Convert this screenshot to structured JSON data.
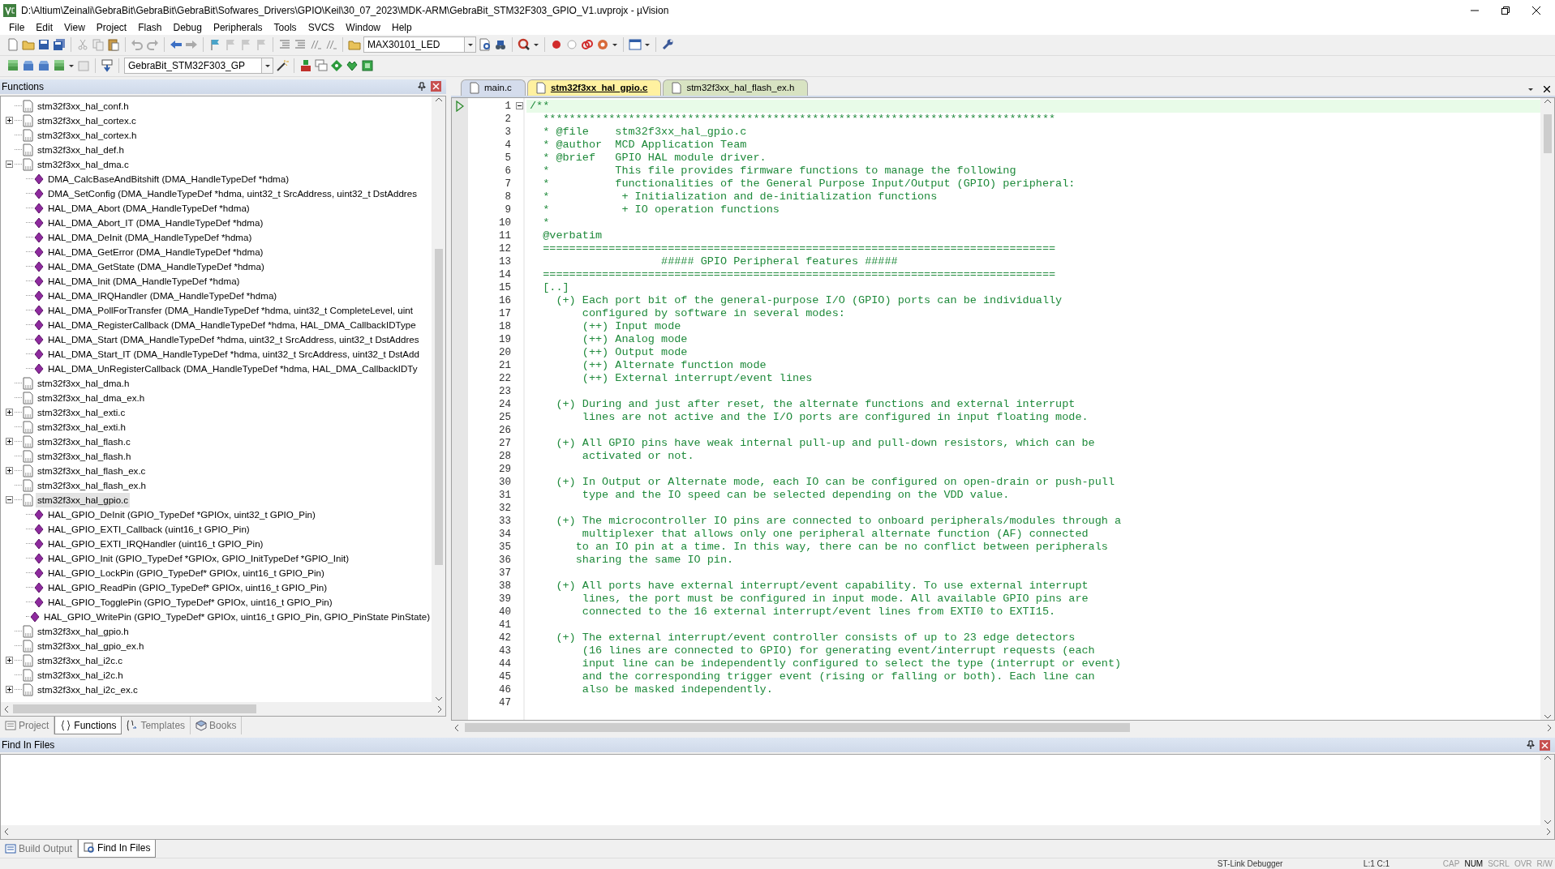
{
  "window": {
    "title": "D:\\Altium\\Zeinali\\GebraBit\\GebraBit\\GebraBit\\Sofwares_Drivers\\GPIO\\Keil\\30_07_2023\\MDK-ARM\\GebraBit_STM32F303_GPIO_V1.uvprojx - µVision"
  },
  "menu": [
    "File",
    "Edit",
    "View",
    "Project",
    "Flash",
    "Debug",
    "Peripherals",
    "Tools",
    "SVCS",
    "Window",
    "Help"
  ],
  "toolbar": {
    "find_combo": "MAX30101_LED",
    "target_combo": "GebraBit_STM32F303_GP"
  },
  "functions_panel": {
    "title": "Functions",
    "tree": [
      {
        "label": "stm32f3xx_hal_conf.h",
        "kind": "file",
        "selected": false
      },
      {
        "label": "stm32f3xx_hal_cortex.c",
        "kind": "file",
        "selected": false,
        "expanded": false
      },
      {
        "label": "stm32f3xx_hal_cortex.h",
        "kind": "file",
        "selected": false
      },
      {
        "label": "stm32f3xx_hal_def.h",
        "kind": "file",
        "selected": false
      },
      {
        "label": "stm32f3xx_hal_dma.c",
        "kind": "file",
        "selected": false,
        "expanded": true,
        "children": [
          {
            "label": "DMA_CalcBaseAndBitshift (DMA_HandleTypeDef *hdma)",
            "kind": "function",
            "selected": false
          },
          {
            "label": "DMA_SetConfig (DMA_HandleTypeDef *hdma, uint32_t SrcAddress, uint32_t DstAddres",
            "kind": "function",
            "selected": false
          },
          {
            "label": "HAL_DMA_Abort (DMA_HandleTypeDef *hdma)",
            "kind": "function",
            "selected": false
          },
          {
            "label": "HAL_DMA_Abort_IT (DMA_HandleTypeDef *hdma)",
            "kind": "function",
            "selected": false
          },
          {
            "label": "HAL_DMA_DeInit (DMA_HandleTypeDef *hdma)",
            "kind": "function",
            "selected": false
          },
          {
            "label": "HAL_DMA_GetError (DMA_HandleTypeDef *hdma)",
            "kind": "function",
            "selected": false
          },
          {
            "label": "HAL_DMA_GetState (DMA_HandleTypeDef *hdma)",
            "kind": "function",
            "selected": false
          },
          {
            "label": "HAL_DMA_Init (DMA_HandleTypeDef *hdma)",
            "kind": "function",
            "selected": false
          },
          {
            "label": "HAL_DMA_IRQHandler (DMA_HandleTypeDef *hdma)",
            "kind": "function",
            "selected": false
          },
          {
            "label": "HAL_DMA_PollForTransfer (DMA_HandleTypeDef *hdma, uint32_t CompleteLevel, uint",
            "kind": "function",
            "selected": false
          },
          {
            "label": "HAL_DMA_RegisterCallback (DMA_HandleTypeDef *hdma, HAL_DMA_CallbackIDType",
            "kind": "function",
            "selected": false
          },
          {
            "label": "HAL_DMA_Start (DMA_HandleTypeDef *hdma, uint32_t SrcAddress, uint32_t DstAddres",
            "kind": "function",
            "selected": false
          },
          {
            "label": "HAL_DMA_Start_IT (DMA_HandleTypeDef *hdma, uint32_t SrcAddress, uint32_t DstAdd",
            "kind": "function",
            "selected": false
          },
          {
            "label": "HAL_DMA_UnRegisterCallback (DMA_HandleTypeDef *hdma, HAL_DMA_CallbackIDTy",
            "kind": "function",
            "selected": false
          }
        ]
      },
      {
        "label": "stm32f3xx_hal_dma.h",
        "kind": "file",
        "selected": false
      },
      {
        "label": "stm32f3xx_hal_dma_ex.h",
        "kind": "file",
        "selected": false
      },
      {
        "label": "stm32f3xx_hal_exti.c",
        "kind": "file",
        "selected": false,
        "expanded": false
      },
      {
        "label": "stm32f3xx_hal_exti.h",
        "kind": "file",
        "selected": false
      },
      {
        "label": "stm32f3xx_hal_flash.c",
        "kind": "file",
        "selected": false,
        "expanded": false
      },
      {
        "label": "stm32f3xx_hal_flash.h",
        "kind": "file",
        "selected": false
      },
      {
        "label": "stm32f3xx_hal_flash_ex.c",
        "kind": "file",
        "selected": false,
        "expanded": false
      },
      {
        "label": "stm32f3xx_hal_flash_ex.h",
        "kind": "file",
        "selected": false
      },
      {
        "label": "stm32f3xx_hal_gpio.c",
        "kind": "file",
        "selected": true,
        "expanded": true,
        "children": [
          {
            "label": "HAL_GPIO_DeInit (GPIO_TypeDef *GPIOx, uint32_t GPIO_Pin)",
            "kind": "function",
            "selected": false
          },
          {
            "label": "HAL_GPIO_EXTI_Callback (uint16_t GPIO_Pin)",
            "kind": "function",
            "selected": false
          },
          {
            "label": "HAL_GPIO_EXTI_IRQHandler (uint16_t GPIO_Pin)",
            "kind": "function",
            "selected": false
          },
          {
            "label": "HAL_GPIO_Init (GPIO_TypeDef *GPIOx, GPIO_InitTypeDef *GPIO_Init)",
            "kind": "function",
            "selected": false
          },
          {
            "label": "HAL_GPIO_LockPin (GPIO_TypeDef* GPIOx, uint16_t GPIO_Pin)",
            "kind": "function",
            "selected": false
          },
          {
            "label": "HAL_GPIO_ReadPin (GPIO_TypeDef* GPIOx, uint16_t GPIO_Pin)",
            "kind": "function",
            "selected": false
          },
          {
            "label": "HAL_GPIO_TogglePin (GPIO_TypeDef* GPIOx, uint16_t GPIO_Pin)",
            "kind": "function",
            "selected": false
          },
          {
            "label": "HAL_GPIO_WritePin (GPIO_TypeDef* GPIOx, uint16_t GPIO_Pin, GPIO_PinState PinState)",
            "kind": "function",
            "selected": false
          }
        ]
      },
      {
        "label": "stm32f3xx_hal_gpio.h",
        "kind": "file",
        "selected": false
      },
      {
        "label": "stm32f3xx_hal_gpio_ex.h",
        "kind": "file",
        "selected": false
      },
      {
        "label": "stm32f3xx_hal_i2c.c",
        "kind": "file",
        "selected": false,
        "expanded": false
      },
      {
        "label": "stm32f3xx_hal_i2c.h",
        "kind": "file",
        "selected": false
      },
      {
        "label": "stm32f3xx_hal_i2c_ex.c",
        "kind": "file",
        "selected": false,
        "expanded": false
      }
    ],
    "tabs": [
      {
        "label": "Project",
        "selected": false
      },
      {
        "label": "Functions",
        "selected": true
      },
      {
        "label": "Templates",
        "selected": false
      },
      {
        "label": "Books",
        "selected": false
      }
    ]
  },
  "editor": {
    "tabs": [
      {
        "label": "main.c",
        "selected": false,
        "color": "#d4dcec"
      },
      {
        "label": "stm32f3xx_hal_gpio.c",
        "selected": true,
        "color": "#fff1a0"
      },
      {
        "label": "stm32f3xx_hal_flash_ex.h",
        "selected": false,
        "color": "#d8e3c2"
      }
    ],
    "lines": [
      {
        "n": "1",
        "text": "/**",
        "current": true,
        "fold_open": true
      },
      {
        "n": "2",
        "text": "  ******************************************************************************",
        "current": false
      },
      {
        "n": "3",
        "text": "  * @file    stm32f3xx_hal_gpio.c",
        "current": false
      },
      {
        "n": "4",
        "text": "  * @author  MCD Application Team",
        "current": false
      },
      {
        "n": "5",
        "text": "  * @brief   GPIO HAL module driver.",
        "current": false
      },
      {
        "n": "6",
        "text": "  *          This file provides firmware functions to manage the following",
        "current": false
      },
      {
        "n": "7",
        "text": "  *          functionalities of the General Purpose Input/Output (GPIO) peripheral:",
        "current": false
      },
      {
        "n": "8",
        "text": "  *           + Initialization and de-initialization functions",
        "current": false
      },
      {
        "n": "9",
        "text": "  *           + IO operation functions",
        "current": false
      },
      {
        "n": "10",
        "text": "  *",
        "current": false
      },
      {
        "n": "11",
        "text": "  @verbatim",
        "current": false
      },
      {
        "n": "12",
        "text": "  ==============================================================================",
        "current": false
      },
      {
        "n": "13",
        "text": "                    ##### GPIO Peripheral features #####",
        "current": false
      },
      {
        "n": "14",
        "text": "  ==============================================================================",
        "current": false
      },
      {
        "n": "15",
        "text": "  [..]",
        "current": false
      },
      {
        "n": "16",
        "text": "    (+) Each port bit of the general-purpose I/O (GPIO) ports can be individually",
        "current": false
      },
      {
        "n": "17",
        "text": "        configured by software in several modes:",
        "current": false
      },
      {
        "n": "18",
        "text": "        (++) Input mode",
        "current": false
      },
      {
        "n": "19",
        "text": "        (++) Analog mode",
        "current": false
      },
      {
        "n": "20",
        "text": "        (++) Output mode",
        "current": false
      },
      {
        "n": "21",
        "text": "        (++) Alternate function mode",
        "current": false
      },
      {
        "n": "22",
        "text": "        (++) External interrupt/event lines",
        "current": false
      },
      {
        "n": "23",
        "current": false
      },
      {
        "n": "24",
        "text": "    (+) During and just after reset, the alternate functions and external interrupt",
        "current": false
      },
      {
        "n": "25",
        "text": "        lines are not active and the I/O ports are configured in input floating mode.",
        "current": false
      },
      {
        "n": "26",
        "current": false
      },
      {
        "n": "27",
        "text": "    (+) All GPIO pins have weak internal pull-up and pull-down resistors, which can be",
        "current": false
      },
      {
        "n": "28",
        "text": "        activated or not.",
        "current": false
      },
      {
        "n": "29",
        "current": false
      },
      {
        "n": "30",
        "text": "    (+) In Output or Alternate mode, each IO can be configured on open-drain or push-pull",
        "current": false
      },
      {
        "n": "31",
        "text": "        type and the IO speed can be selected depending on the VDD value.",
        "current": false
      },
      {
        "n": "32",
        "current": false
      },
      {
        "n": "33",
        "text": "    (+) The microcontroller IO pins are connected to onboard peripherals/modules through a",
        "current": false
      },
      {
        "n": "34",
        "text": "        multiplexer that allows only one peripheral alternate function (AF) connected",
        "current": false
      },
      {
        "n": "35",
        "text": "       to an IO pin at a time. In this way, there can be no conflict between peripherals",
        "current": false
      },
      {
        "n": "36",
        "text": "       sharing the same IO pin.",
        "current": false
      },
      {
        "n": "37",
        "current": false
      },
      {
        "n": "38",
        "text": "    (+) All ports have external interrupt/event capability. To use external interrupt",
        "current": false
      },
      {
        "n": "39",
        "text": "        lines, the port must be configured in input mode. All available GPIO pins are",
        "current": false
      },
      {
        "n": "40",
        "text": "        connected to the 16 external interrupt/event lines from EXTI0 to EXTI15.",
        "current": false
      },
      {
        "n": "41",
        "current": false
      },
      {
        "n": "42",
        "text": "    (+) The external interrupt/event controller consists of up to 23 edge detectors",
        "current": false
      },
      {
        "n": "43",
        "text": "        (16 lines are connected to GPIO) for generating event/interrupt requests (each",
        "current": false
      },
      {
        "n": "44",
        "text": "        input line can be independently configured to select the type (interrupt or event)",
        "current": false
      },
      {
        "n": "45",
        "text": "        and the corresponding trigger event (rising or falling or both). Each line can",
        "current": false
      },
      {
        "n": "46",
        "text": "        also be masked independently.",
        "current": false
      },
      {
        "n": "47",
        "current": false
      }
    ]
  },
  "find_panel": {
    "title": "Find In Files",
    "tabs": [
      {
        "label": "Build Output",
        "selected": false
      },
      {
        "label": "Find In Files",
        "selected": true
      }
    ]
  },
  "status_bar": {
    "debugger": "ST-Link Debugger",
    "position": "L:1 C:1",
    "keys": [
      {
        "label": "CAP",
        "on": false
      },
      {
        "label": "NUM",
        "on": true
      },
      {
        "label": "SCRL",
        "on": false
      },
      {
        "label": "OVR",
        "on": false
      },
      {
        "label": "R/W",
        "on": false
      }
    ]
  }
}
